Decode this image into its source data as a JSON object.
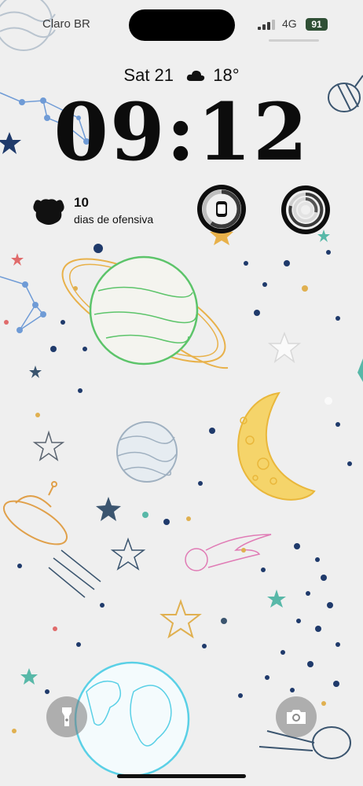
{
  "status_bar": {
    "carrier": "Claro BR",
    "network": "4G",
    "battery": "91",
    "signal_bars_filled": 3,
    "signal_bars_total": 4
  },
  "lock_screen": {
    "day_date": "Sat 21",
    "weather_icon": "cloud-icon",
    "temperature": "18°",
    "time": "09:12"
  },
  "widgets": {
    "streak": {
      "icon": "duolingo-owl-icon",
      "count": "10",
      "label": "dias de ofensiva"
    },
    "watch_battery": {
      "icon": "watch-icon",
      "level": 0.6
    },
    "activity": {
      "icon": "activity-rings-icon"
    }
  },
  "quick_actions": {
    "left": "flashlight-icon",
    "right": "camera-icon"
  },
  "colors": {
    "battery_bg": "#2f4f35",
    "background": "#efefef",
    "planet_green": "#5cc46a",
    "planet_gold": "#e8b14a",
    "moon_yellow": "#f2c94c",
    "star_navy": "#1f3a6b",
    "earth_cyan": "#5ad0e6",
    "comet_pink": "#e07bb5"
  }
}
